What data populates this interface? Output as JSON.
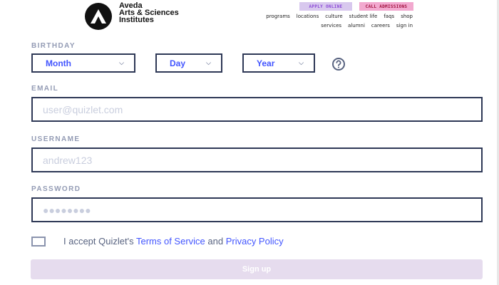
{
  "header": {
    "logo_text": "Aveda\nArts & Sciences\nInstitutes",
    "apply_label": "APPLY ONLINE",
    "call_label": "CALL ADMISSIONS",
    "nav_row1": [
      "programs",
      "locations",
      "culture",
      "student life",
      "faqs",
      "shop"
    ],
    "nav_row2": [
      "services",
      "alumni",
      "careers",
      "sign in"
    ]
  },
  "form": {
    "birthday": {
      "label": "BIRTHDAY",
      "month": "Month",
      "day": "Day",
      "year": "Year"
    },
    "email": {
      "label": "EMAIL",
      "placeholder": "user@quizlet.com"
    },
    "username": {
      "label": "USERNAME",
      "placeholder": "andrew123"
    },
    "password": {
      "label": "PASSWORD",
      "placeholder": "●●●●●●●●"
    },
    "terms": {
      "prefix": "I accept Quizlet's ",
      "tos": "Terms of Service",
      "and": " and ",
      "privacy": "Privacy Policy"
    },
    "submit_label": "Sign up"
  },
  "colors": {
    "link": "#4255ff",
    "border": "#2e3856",
    "label": "#939bb4",
    "signup_bg": "#e6dcee",
    "apply_bg": "#d8c8ee",
    "call_bg": "#f2a9cf"
  },
  "icons": {
    "logo": "aveda-triangle-logo-icon",
    "chevron": "chevron-down-icon",
    "help": "question-circle-icon"
  }
}
